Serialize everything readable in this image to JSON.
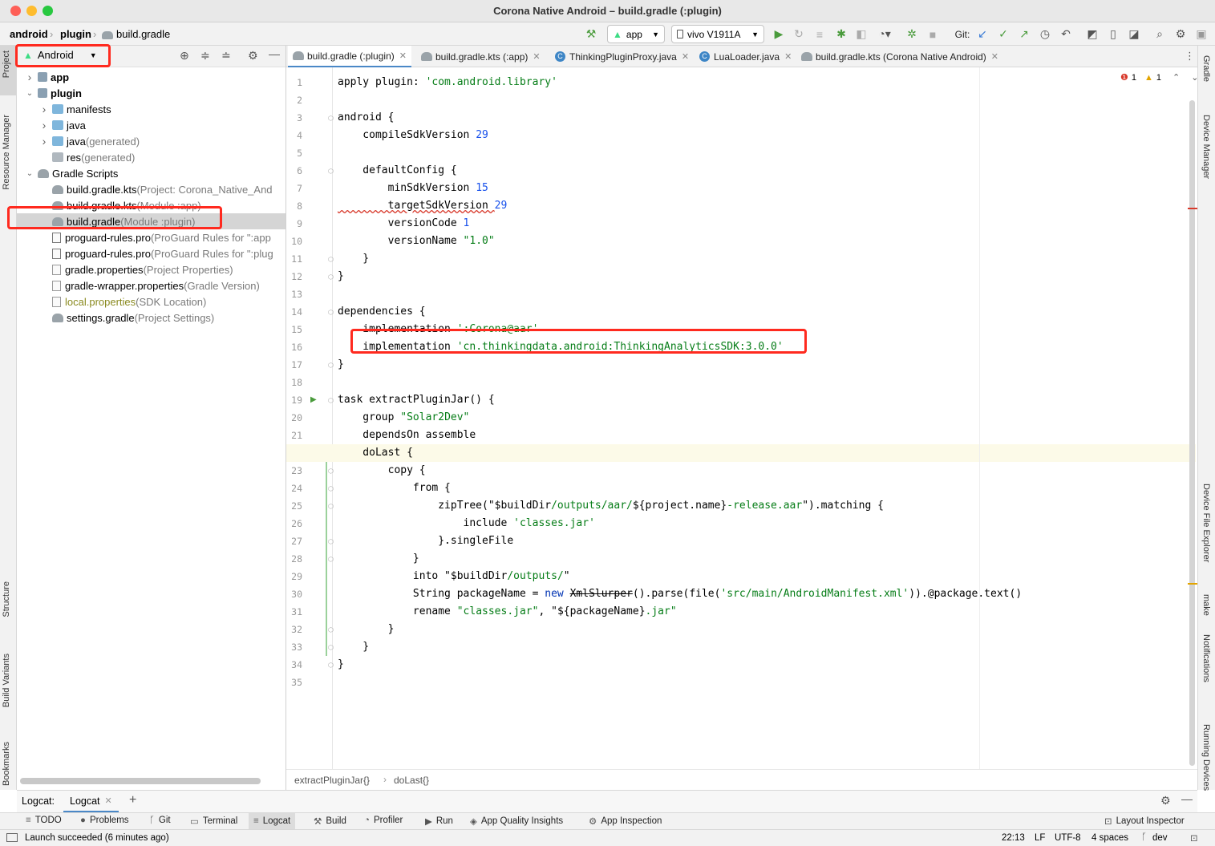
{
  "window": {
    "title": "Corona Native Android – build.gradle (:plugin)"
  },
  "breadcrumb": [
    "android",
    "plugin",
    "build.gradle"
  ],
  "toolbar": {
    "run_config": "app",
    "device": "vivo V1911A",
    "git_label": "Git:"
  },
  "left_strip": [
    "Project",
    "Resource Manager",
    "Structure",
    "Build Variants",
    "Bookmarks"
  ],
  "right_strip": [
    "Gradle",
    "Device Manager",
    "Device File Explorer",
    "make",
    "Notifications",
    "Running Devices"
  ],
  "project_panel": {
    "view_selector": "Android",
    "tree": [
      {
        "label": "app",
        "extra": "",
        "bold": true,
        "indent": 0,
        "arrow": "right",
        "icon": "module"
      },
      {
        "label": "plugin",
        "extra": "",
        "bold": true,
        "indent": 0,
        "arrow": "down",
        "icon": "module"
      },
      {
        "label": "manifests",
        "extra": "",
        "indent": 1,
        "arrow": "right",
        "icon": "folder"
      },
      {
        "label": "java",
        "extra": "",
        "indent": 1,
        "arrow": "right",
        "icon": "folder"
      },
      {
        "label": "java",
        "extra": " (generated)",
        "indent": 1,
        "arrow": "right",
        "icon": "folder"
      },
      {
        "label": "res",
        "extra": " (generated)",
        "indent": 1,
        "arrow": "",
        "icon": "folder-gray"
      },
      {
        "label": "Gradle Scripts",
        "extra": "",
        "indent": 0,
        "arrow": "down",
        "icon": "gradle"
      },
      {
        "label": "build.gradle.kts",
        "extra": " (Project: Corona_Native_And",
        "indent": 1,
        "arrow": "",
        "icon": "gradle"
      },
      {
        "label": "build.gradle.kts",
        "extra": " (Module :app)",
        "indent": 1,
        "arrow": "",
        "icon": "gradle"
      },
      {
        "label": "build.gradle",
        "extra": " (Module :plugin)",
        "indent": 1,
        "arrow": "",
        "icon": "gradle",
        "selected": true
      },
      {
        "label": "proguard-rules.pro",
        "extra": " (ProGuard Rules for \":app",
        "indent": 1,
        "arrow": "",
        "icon": "doc"
      },
      {
        "label": "proguard-rules.pro",
        "extra": " (ProGuard Rules for \":plug",
        "indent": 1,
        "arrow": "",
        "icon": "doc"
      },
      {
        "label": "gradle.properties",
        "extra": " (Project Properties)",
        "indent": 1,
        "arrow": "",
        "icon": "props"
      },
      {
        "label": "gradle-wrapper.properties",
        "extra": " (Gradle Version)",
        "indent": 1,
        "arrow": "",
        "icon": "props"
      },
      {
        "label": "local.properties",
        "extra": " (SDK Location)",
        "indent": 1,
        "arrow": "",
        "icon": "props",
        "olive": true
      },
      {
        "label": "settings.gradle",
        "extra": " (Project Settings)",
        "indent": 1,
        "arrow": "",
        "icon": "gradle"
      }
    ]
  },
  "tabs": [
    {
      "label": "build.gradle (:plugin)",
      "icon": "gradle",
      "active": true
    },
    {
      "label": "build.gradle.kts (:app)",
      "icon": "gradle"
    },
    {
      "label": "ThinkingPluginProxy.java",
      "icon": "class"
    },
    {
      "label": "LuaLoader.java",
      "icon": "class"
    },
    {
      "label": "build.gradle.kts (Corona Native Android)",
      "icon": "gradle"
    }
  ],
  "inspections": {
    "errors": "1",
    "warnings": "1"
  },
  "code_lines": [
    [
      [
        "apply plugin: ",
        ""
      ],
      [
        "'com.android.library'",
        "str"
      ]
    ],
    [],
    [
      [
        "android {",
        ""
      ]
    ],
    [
      [
        "    compileSdkVersion ",
        ""
      ],
      [
        "29",
        "num"
      ]
    ],
    [],
    [
      [
        "    defaultConfig {",
        ""
      ]
    ],
    [
      [
        "        minSdkVersion ",
        ""
      ],
      [
        "15",
        "num"
      ]
    ],
    [
      [
        "        targetSdkVersion ",
        ""
      ],
      [
        "29",
        "num"
      ]
    ],
    [
      [
        "        versionCode ",
        ""
      ],
      [
        "1",
        "num"
      ]
    ],
    [
      [
        "        versionName ",
        ""
      ],
      [
        "\"1.0\"",
        "str"
      ]
    ],
    [
      [
        "    }",
        ""
      ]
    ],
    [
      [
        "}",
        ""
      ]
    ],
    [],
    [
      [
        "dependencies {",
        ""
      ]
    ],
    [
      [
        "    implementation ",
        ""
      ],
      [
        "':Corona@aar'",
        "str"
      ]
    ],
    [
      [
        "    implementation ",
        ""
      ],
      [
        "'cn.thinkingdata.android:ThinkingAnalyticsSDK:3.0.0'",
        "str"
      ]
    ],
    [
      [
        "}",
        ""
      ]
    ],
    [],
    [
      [
        "task extractPluginJar() {",
        ""
      ]
    ],
    [
      [
        "    group ",
        ""
      ],
      [
        "\"Solar2Dev\"",
        "str"
      ]
    ],
    [
      [
        "    dependsOn assemble",
        ""
      ]
    ],
    [
      [
        "    doLast {",
        ""
      ]
    ],
    [
      [
        "        copy {",
        ""
      ]
    ],
    [
      [
        "            from {",
        ""
      ]
    ],
    [
      [
        "                zipTree(\"$buildDir",
        ""
      ],
      [
        "/outputs/aar/",
        "str"
      ],
      [
        "${project.name}",
        ""
      ],
      [
        "-release.aar",
        "str"
      ],
      [
        "\").matching {",
        ""
      ]
    ],
    [
      [
        "                    include ",
        ""
      ],
      [
        "'classes.jar'",
        "str"
      ]
    ],
    [
      [
        "                }.singleFile",
        ""
      ]
    ],
    [
      [
        "            }",
        ""
      ]
    ],
    [
      [
        "            into \"$buildDir",
        ""
      ],
      [
        "/outputs/",
        "str"
      ],
      [
        "\"",
        ""
      ]
    ],
    [
      [
        "            String packageName = ",
        ""
      ],
      [
        "new ",
        "kw"
      ],
      [
        "XmlSlurper",
        "strike"
      ],
      [
        "().parse(file(",
        ""
      ],
      [
        "'src/main/AndroidManifest.xml'",
        "str"
      ],
      [
        ")).@package.text()",
        ""
      ]
    ],
    [
      [
        "            rename ",
        ""
      ],
      [
        "\"classes.jar\"",
        "str"
      ],
      [
        ", \"",
        ""
      ],
      [
        "${packageName}",
        ""
      ],
      [
        ".jar\"",
        "str"
      ]
    ],
    [
      [
        "        }",
        ""
      ]
    ],
    [
      [
        "    }",
        ""
      ]
    ],
    [
      [
        "}",
        ""
      ]
    ],
    []
  ],
  "editor_breadcrumb": [
    "extractPluginJar{}",
    "doLast{}"
  ],
  "logcat_bar": {
    "label": "Logcat:",
    "tab": "Logcat"
  },
  "bottom_tools": [
    "TODO",
    "Problems",
    "Git",
    "Terminal",
    "Logcat",
    "Build",
    "Profiler",
    "Run",
    "App Quality Insights",
    "App Inspection",
    "Layout Inspector"
  ],
  "status": {
    "message": "Launch succeeded (6 minutes ago)",
    "position": "22:13",
    "line_sep": "LF",
    "encoding": "UTF-8",
    "indent": "4 spaces",
    "branch": "dev"
  },
  "colors": {
    "accent": "#4a88c7",
    "highlight": "#ff2a1f",
    "string": "#067d17",
    "number": "#1750eb"
  }
}
